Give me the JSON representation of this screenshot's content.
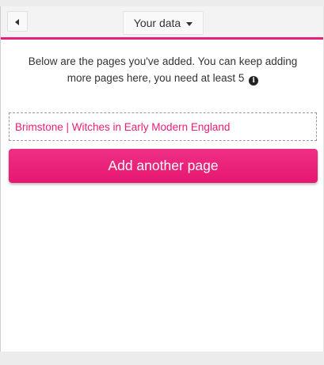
{
  "header": {
    "back_icon": "caret-left-icon",
    "menu_label": "Your data",
    "menu_icon": "caret-down-icon",
    "accent_color": "#e91e7a"
  },
  "intro": {
    "text": "Below are the pages you've added. You can keep adding more pages here, you need at least 5",
    "icon": "info-icon",
    "icon_glyph": "i"
  },
  "pages": [
    {
      "label": "Brimstone | Witches in Early Modern England"
    }
  ],
  "actions": {
    "add_page_label": "Add another page",
    "button_color": "#e91e7a"
  }
}
